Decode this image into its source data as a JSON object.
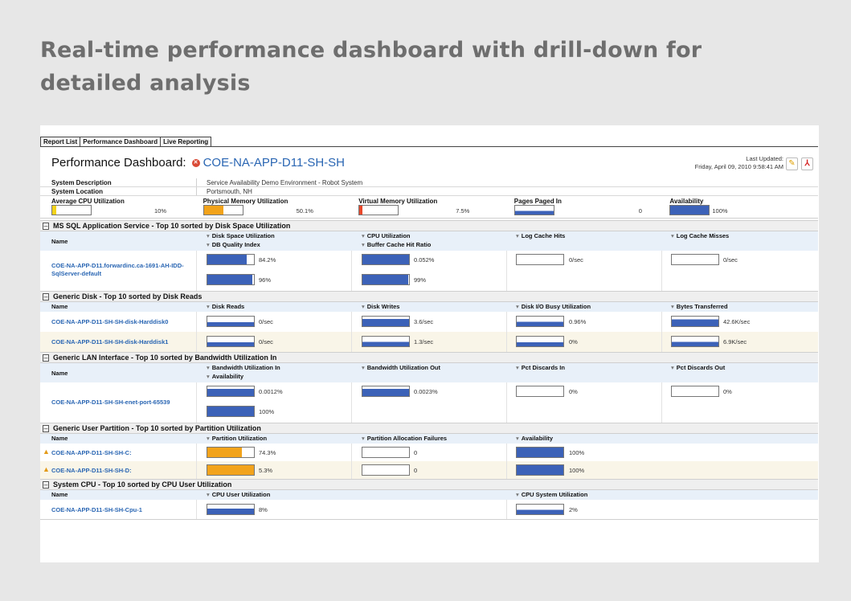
{
  "headline": "Real-time performance dashboard with drill-down for detailed analysis",
  "tabs": [
    "Report List",
    "Performance Dashboard",
    "Live Reporting"
  ],
  "dashboard": {
    "title_label": "Performance Dashboard:",
    "host": "COE-NA-APP-D11-SH-SH",
    "last_updated_label": "Last Updated:",
    "last_updated_value": "Friday, April 09, 2010 9:58:41 AM"
  },
  "system": {
    "description_label": "System Description",
    "description_value": "Service Availability Demo Environment - Robot System",
    "location_label": "System Location",
    "location_value": "Portsmouth, NH"
  },
  "summary": [
    {
      "label": "Average CPU Utilization",
      "value": "10%",
      "level": 0.1,
      "color": "#f2d21b"
    },
    {
      "label": "Physical Memory Utilization",
      "value": "50.1%",
      "level": 0.501,
      "color": "#f2a31b"
    },
    {
      "label": "Virtual Memory Utilization",
      "value": "7.5%",
      "level": 0.075,
      "color": "#e8482b"
    },
    {
      "label": "Pages Paged In",
      "value": "0",
      "level": 0.0,
      "color": "#3c62b8"
    },
    {
      "label": "Availability",
      "value": "100%",
      "level": 1.0,
      "color": "#3c62b8"
    }
  ],
  "name_header": "Name",
  "colors": {
    "blue": "#3c62b8",
    "orange": "#f2a31b",
    "link": "#2a66b3"
  },
  "sections": {
    "mssql": {
      "title": "MS SQL Application Service - Top 10 sorted by Disk Space Utilization",
      "cols": [
        "Disk Space Utilization",
        "CPU Utilization",
        "Log Cache Hits",
        "Log Cache Misses"
      ],
      "cols2": [
        "DB Quality Index",
        "Buffer Cache Hit Ratio"
      ],
      "host_line1": "COE-NA-APP-D11.forwardinc.ca-1691-AH-IDD-",
      "host_line2": "SqlServer-default",
      "row1": [
        "84.2%",
        "0.052%",
        "0/sec",
        "0/sec"
      ],
      "row2": [
        "96%",
        "99%"
      ]
    },
    "disk": {
      "title": "Generic Disk - Top 10 sorted by Disk Reads",
      "cols": [
        "Disk Reads",
        "Disk Writes",
        "Disk I/O Busy Utilization",
        "Bytes Transferred"
      ],
      "rows": [
        {
          "host": "COE-NA-APP-D11-SH-SH-disk-Harddisk0",
          "values": [
            "0/sec",
            "3.6/sec",
            "0.96%",
            "42.6K/sec"
          ]
        },
        {
          "host": "COE-NA-APP-D11-SH-SH-disk-Harddisk1",
          "values": [
            "0/sec",
            "1.3/sec",
            "0%",
            "6.9K/sec"
          ]
        }
      ]
    },
    "lan": {
      "title": "Generic LAN Interface - Top 10 sorted by Bandwidth Utilization In",
      "cols": [
        "Bandwidth Utilization In",
        "Bandwidth Utilization Out",
        "Pct Discards In",
        "Pct Discards Out"
      ],
      "cols2": [
        "Availability"
      ],
      "host": "COE-NA-APP-D11-SH-SH-enet-port-65539",
      "row1": [
        "0.0012%",
        "0.0023%",
        "0%",
        "0%"
      ],
      "row2": [
        "100%"
      ]
    },
    "partition": {
      "title": "Generic User Partition - Top 10 sorted by Partition Utilization",
      "cols": [
        "Partition Utilization",
        "Partition Allocation Failures",
        "Availability"
      ],
      "rows": [
        {
          "host": "COE-NA-APP-D11-SH-SH-C:",
          "values": [
            "74.3%",
            "0",
            "100%"
          ]
        },
        {
          "host": "COE-NA-APP-D11-SH-SH-D:",
          "values": [
            "5.3%",
            "0",
            "100%"
          ]
        }
      ]
    },
    "cpu": {
      "title": "System CPU - Top 10 sorted by CPU User Utilization",
      "cols": [
        "CPU User Utilization",
        "CPU System Utilization"
      ],
      "rows": [
        {
          "host": "COE-NA-APP-D11-SH-SH-Cpu-1",
          "values": [
            "8%",
            "2%"
          ]
        }
      ]
    }
  }
}
